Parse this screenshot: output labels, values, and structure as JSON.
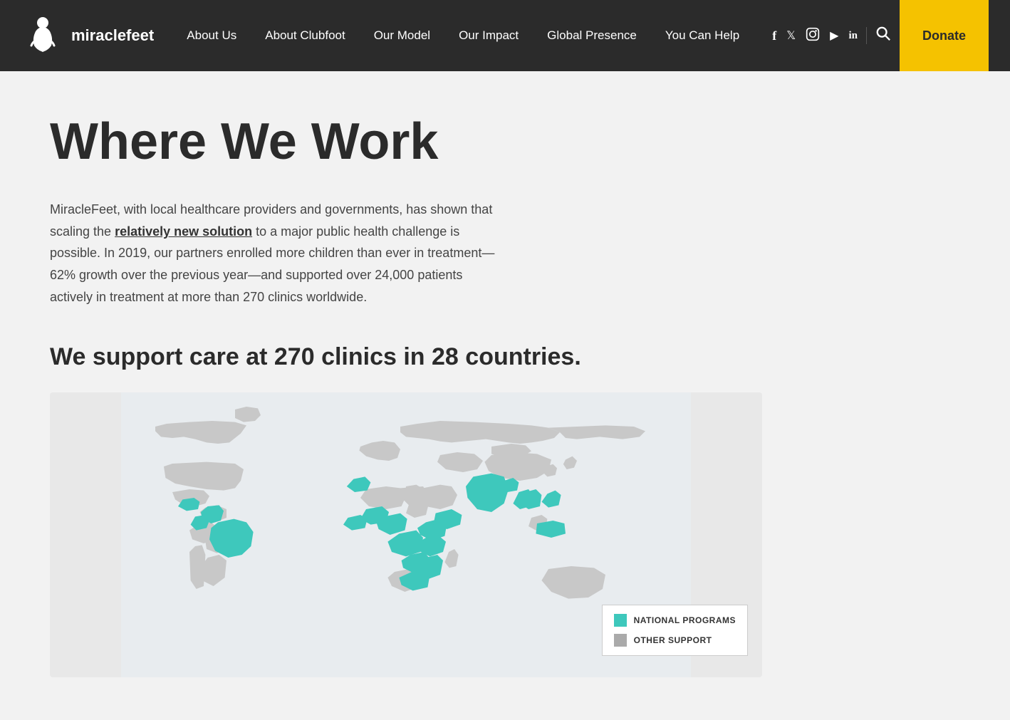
{
  "nav": {
    "logo_alt": "MiracleFeet",
    "logo_text": "miraclefeet",
    "links": [
      {
        "label": "About Us",
        "href": "#"
      },
      {
        "label": "About Clubfoot",
        "href": "#"
      },
      {
        "label": "Our Model",
        "href": "#"
      },
      {
        "label": "Our Impact",
        "href": "#"
      },
      {
        "label": "Global Presence",
        "href": "#"
      },
      {
        "label": "You Can Help",
        "href": "#"
      }
    ],
    "social": [
      {
        "name": "facebook",
        "symbol": "f"
      },
      {
        "name": "twitter",
        "symbol": "𝕏"
      },
      {
        "name": "instagram",
        "symbol": "◻"
      },
      {
        "name": "youtube",
        "symbol": "▶"
      },
      {
        "name": "linkedin",
        "symbol": "in"
      }
    ],
    "donate_label": "Donate"
  },
  "main": {
    "page_title": "Where We Work",
    "description_part1": "MiracleFeet, with local healthcare providers and governments, has shown that scaling the ",
    "link_text": "relatively new solution",
    "description_part2": " to a major public health challenge is possible. In 2019, our partners enrolled more children than ever in treatment—62% growth over the previous year—and supported over 24,000 patients actively in treatment at more than 270 clinics worldwide.",
    "subtitle": "We support care at 270 clinics in 28 countries.",
    "legend": {
      "national_programs_label": "NATIONAL PROGRAMS",
      "national_programs_color": "#3ec8bc",
      "other_support_label": "OTHER SUPPORT",
      "other_support_color": "#aaaaaa"
    }
  }
}
